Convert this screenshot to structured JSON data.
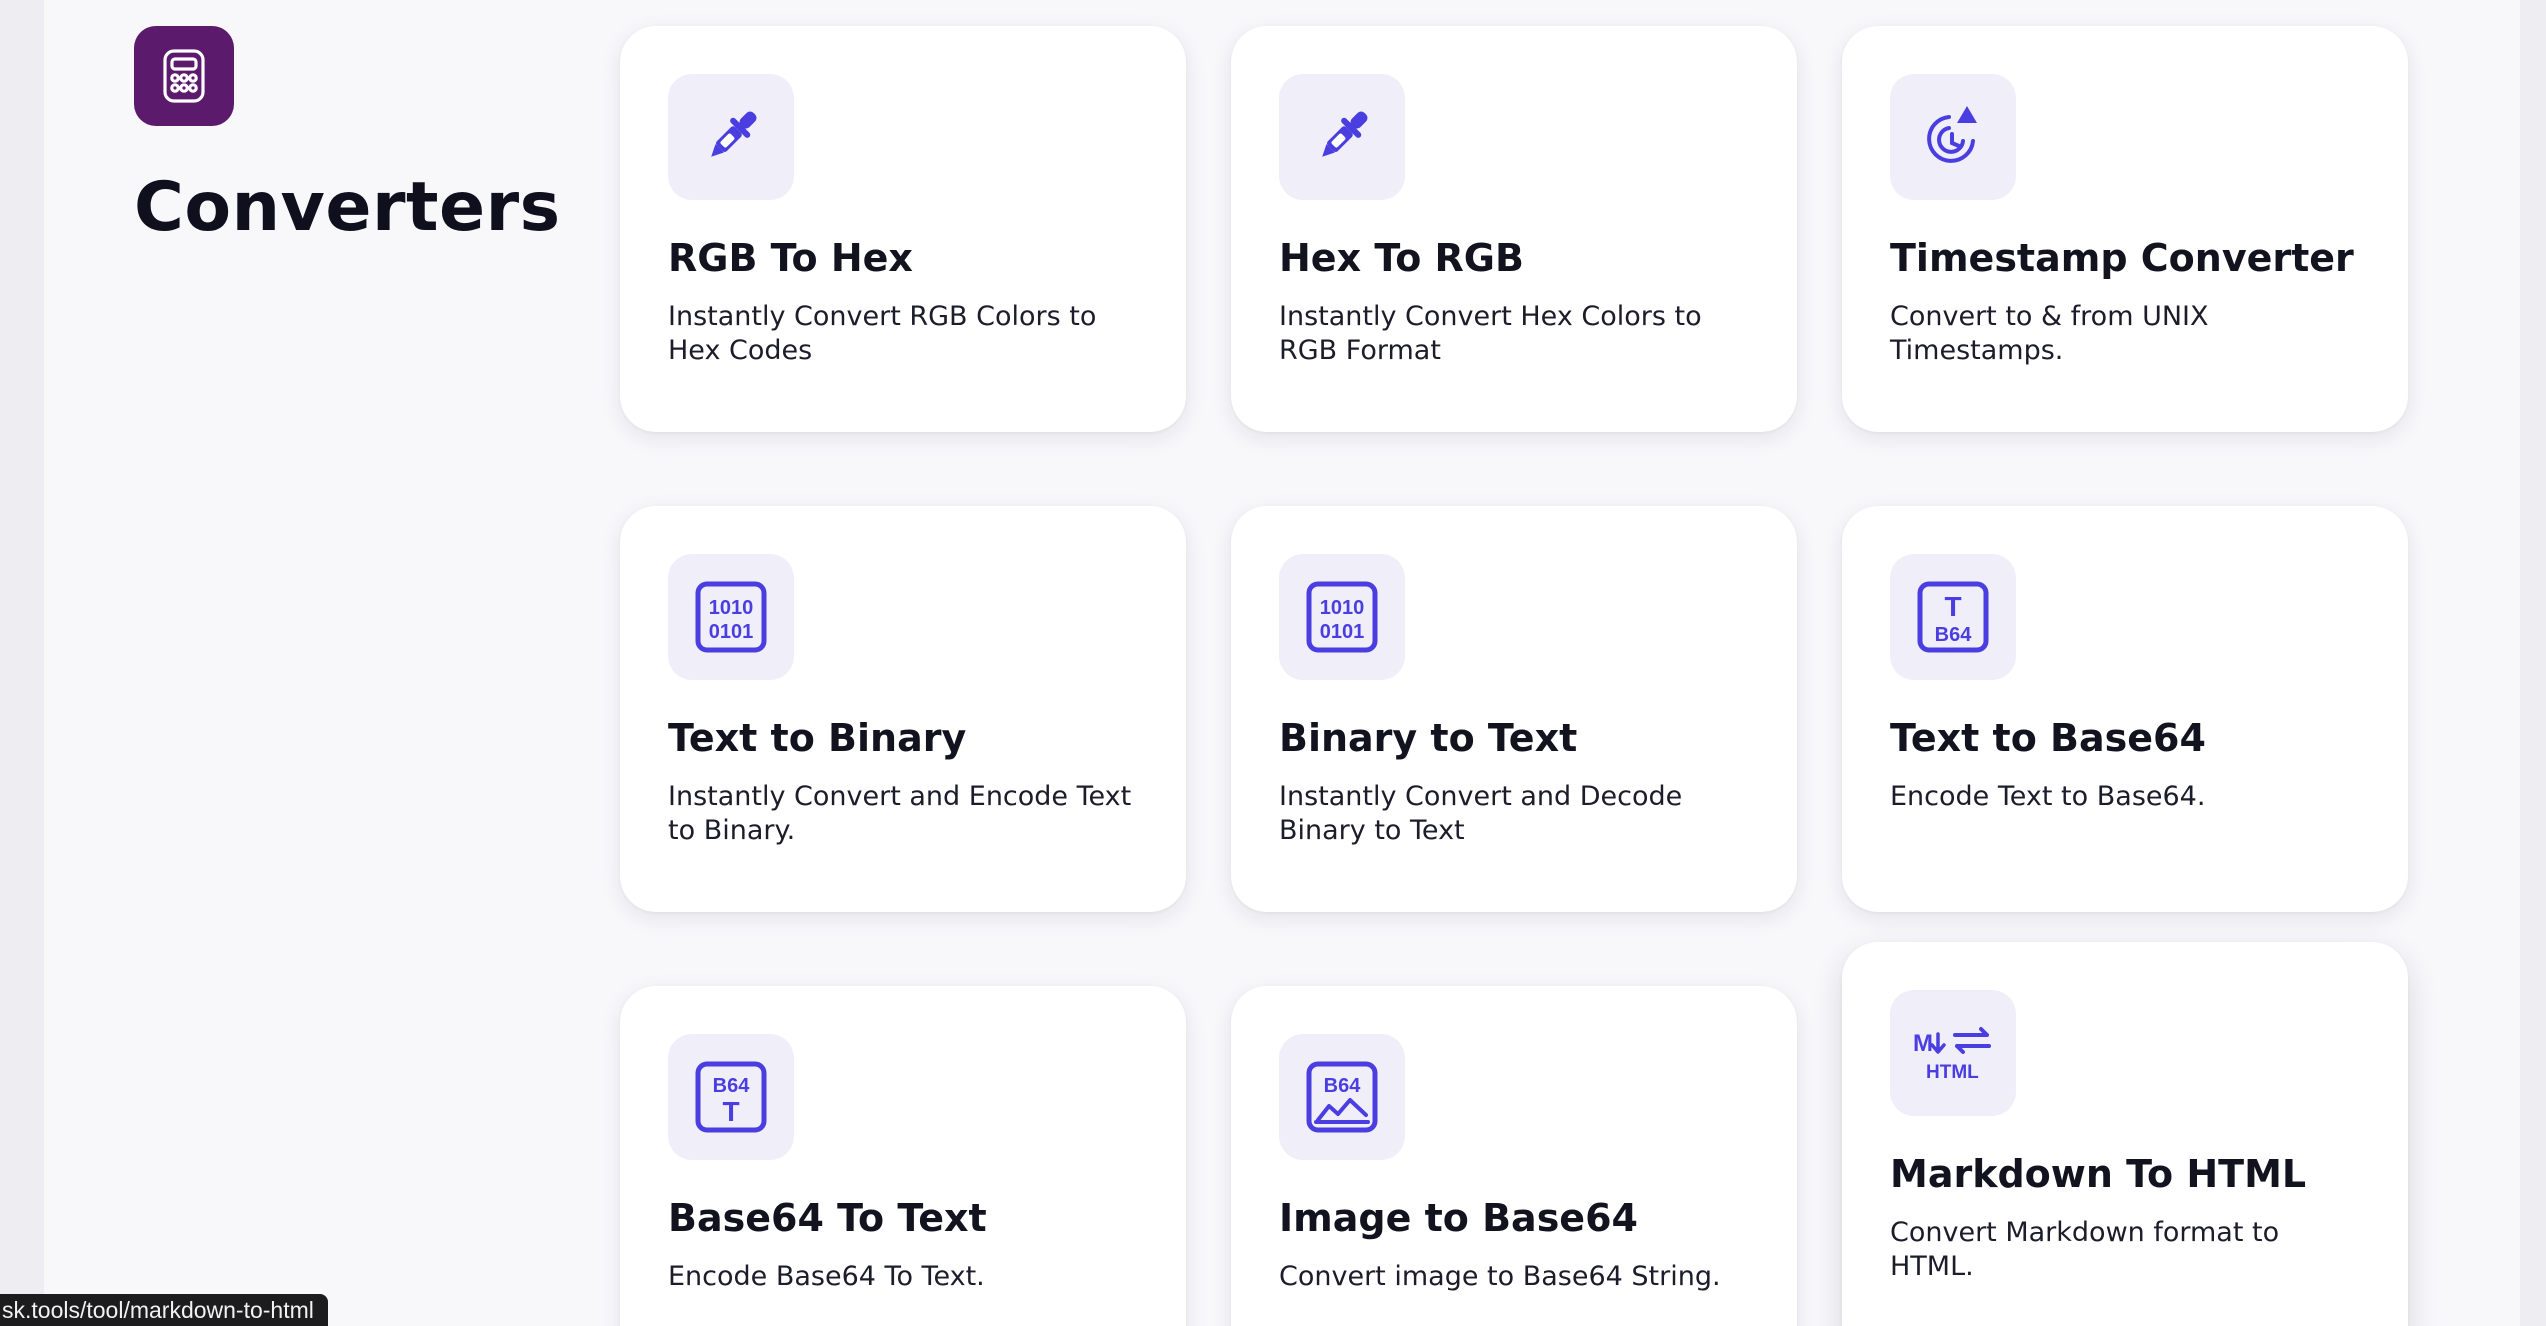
{
  "page": {
    "title": "Converters"
  },
  "icons": {
    "logo": "calculator-icon",
    "accent": "#4b3ee0",
    "logo_bg": "#5b1a6b",
    "icon_bg": "#f0eff9"
  },
  "cards": [
    {
      "title": "RGB To Hex",
      "description": "Instantly Convert RGB Colors to Hex Codes",
      "icon": "eyedropper-icon"
    },
    {
      "title": "Hex To RGB",
      "description": "Instantly Convert Hex Colors to RGB Format",
      "icon": "eyedropper-icon"
    },
    {
      "title": "Timestamp Converter",
      "description": "Convert to & from UNIX Timestamps.",
      "icon": "clock-icon"
    },
    {
      "title": "Text to Binary",
      "description": "Instantly Convert and Encode Text to Binary.",
      "icon": "binary-icon",
      "icon_text_top": "1010",
      "icon_text_bottom": "0101"
    },
    {
      "title": "Binary to Text",
      "description": "Instantly Convert and Decode Binary to Text",
      "icon": "binary-icon",
      "icon_text_top": "1010",
      "icon_text_bottom": "0101"
    },
    {
      "title": "Text to Base64",
      "description": "Encode Text to Base64.",
      "icon": "text-to-base64-icon",
      "icon_text_top": "T",
      "icon_text_bottom": "B64"
    },
    {
      "title": "Base64 To Text",
      "description": "Encode Base64 To Text.",
      "icon": "base64-to-text-icon",
      "icon_text_top": "B64",
      "icon_text_bottom": "T"
    },
    {
      "title": "Image to Base64",
      "description": "Convert image to Base64 String.",
      "icon": "image-base64-icon",
      "icon_text_top": "B64"
    },
    {
      "title": "Markdown To HTML",
      "description": "Convert Markdown format to HTML.",
      "icon": "markdown-icon",
      "icon_text_top": "M",
      "icon_text_bottom": "HTML"
    }
  ],
  "status_bar": {
    "url": "sk.tools/tool/markdown-to-html"
  }
}
